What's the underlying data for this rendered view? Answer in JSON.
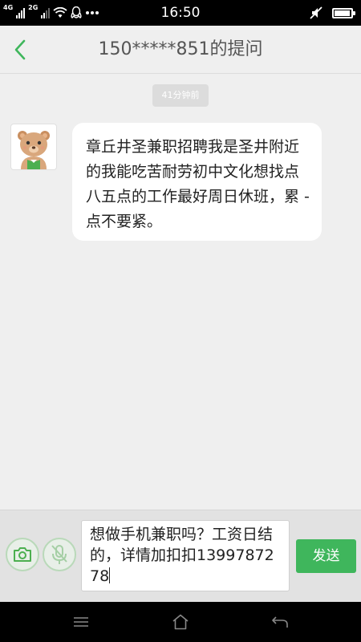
{
  "status_bar": {
    "network_1": "4G",
    "network_2": "2G",
    "time": "16:50",
    "more_icon": "more-dots-icon",
    "battery_level": 0.85
  },
  "header": {
    "title": "150*****851的提问",
    "back_icon": "chevron-left-icon"
  },
  "chat": {
    "timestamp": "41分钟前",
    "messages": [
      {
        "sender": "other",
        "avatar_icon": "bear-avatar-icon",
        "text": "章丘井圣兼职招聘我是圣井附近的我能吃苦耐劳初中文化想找点八五点的工作最好周日休班，累 - 点不要紧。"
      }
    ]
  },
  "input_bar": {
    "camera_icon": "camera-icon",
    "mic_icon": "mic-off-icon",
    "input_value": "想做手机兼职吗？工资日结的，详情加扣扣1399787278",
    "send_label": "发送"
  },
  "nav_bar": {
    "menu_icon": "menu-icon",
    "home_icon": "home-icon",
    "back_icon": "back-arrow-icon"
  },
  "colors": {
    "accent_green": "#3fb65c",
    "header_bg": "#efefef",
    "chat_bg": "#efefef",
    "input_bar_bg": "#e2e2e2"
  }
}
